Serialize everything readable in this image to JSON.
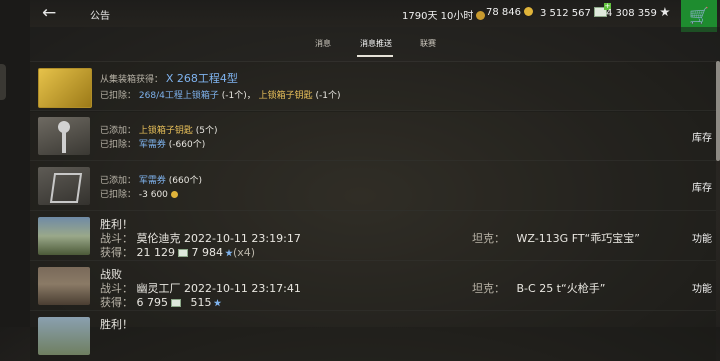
{
  "topbar": {
    "notice_label": "公告",
    "premium": "1790天 10小时",
    "gold": "78 846",
    "credits": "3 512 567",
    "free_xp": "4 308 359"
  },
  "tabs": [
    "消息",
    "消息推送",
    "联赛"
  ],
  "rows": [
    {
      "line1_prefix": "从集装箱获得：",
      "line1_value": "X 268工程4型",
      "line2_prefix": "已扣除：",
      "line2_item1": "268/4工程上锁箱子",
      "line2_q1": "(-1个)，",
      "line2_item2": "上锁箱子钥匙",
      "line2_q2": "(-1个)"
    },
    {
      "line1_prefix": "已添加：",
      "line1_item": "上锁箱子钥匙",
      "line1_qty": "(5个)",
      "line2_prefix": "已扣除：",
      "line2_item": "军需券",
      "line2_qty": "(-660个)",
      "action": "库存"
    },
    {
      "line1_prefix": "已添加：",
      "line1_item": "军需券",
      "line1_qty": "(660个)",
      "line2_prefix": "已扣除：",
      "line2_qty": "-3 600",
      "action": "库存"
    },
    {
      "title": "胜利！",
      "battle_label": "战斗：",
      "battle_value": "莫伦迪克 2022-10-11 23:19:17",
      "reward_label": "获得：",
      "reward_credits": "21 129",
      "reward_xp": "7 984",
      "reward_mult": "(x4)",
      "tank_label": "坦克：",
      "tank_value": "WZ-113G FT“乖巧宝宝”",
      "action": "功能"
    },
    {
      "title": "战败",
      "battle_label": "战斗：",
      "battle_value": "幽灵工厂 2022-10-11 23:17:41",
      "reward_label": "获得：",
      "reward_credits": "6 795",
      "reward_xp": "515",
      "tank_label": "坦克：",
      "tank_value": "B-C 25 t“火枪手”",
      "action": "功能"
    },
    {
      "title": "胜利！"
    }
  ]
}
